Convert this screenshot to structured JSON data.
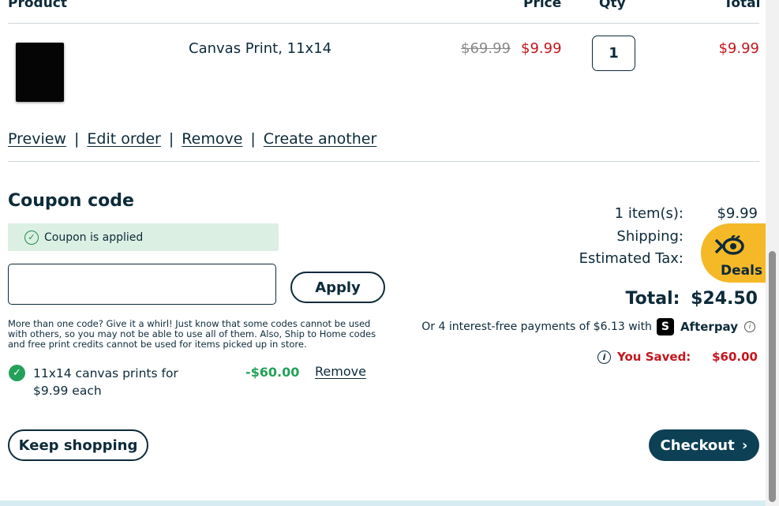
{
  "table_header": {
    "product": "Product",
    "price": "Price",
    "qty": "Qty",
    "total": "Total"
  },
  "item": {
    "name": "Canvas Print, 11x14",
    "original_price": "$69.99",
    "price": "$9.99",
    "qty": "1",
    "total": "$9.99"
  },
  "item_actions": {
    "preview": "Preview",
    "edit": "Edit order",
    "remove": "Remove",
    "create": "Create another",
    "separator": "|"
  },
  "coupon": {
    "heading": "Coupon code",
    "applied_text": "Coupon is applied",
    "input_value": "",
    "apply_label": "Apply",
    "note": "More than one code? Give it a whirl! Just know that some codes cannot be used with others, so you may not be able to use all of them. Also, Ship to Home codes and free print credits cannot be used for items picked up in store.",
    "promo": {
      "text": "11x14 canvas prints for $9.99 each",
      "amount": "-$60.00",
      "remove_label": "Remove"
    }
  },
  "summary": {
    "items_label": "1 item(s):",
    "items_value": "$9.99",
    "shipping_label": "Shipping:",
    "tax_label": "Estimated Tax:",
    "total_label": "Total:",
    "total_value": "$24.50",
    "afterpay_text": "Or 4 interest-free payments of $6.13 with",
    "afterpay_brand": "Afterpay",
    "saved_label": "You Saved:",
    "saved_value": "$60.00"
  },
  "buttons": {
    "keep_shopping": "Keep shopping",
    "checkout": "Checkout"
  },
  "deals": {
    "label": "Deals"
  },
  "colors": {
    "accent": "#0d4055",
    "sale_red": "#c5161d",
    "success_green": "#24a158",
    "deals_yellow": "#f5b928"
  }
}
